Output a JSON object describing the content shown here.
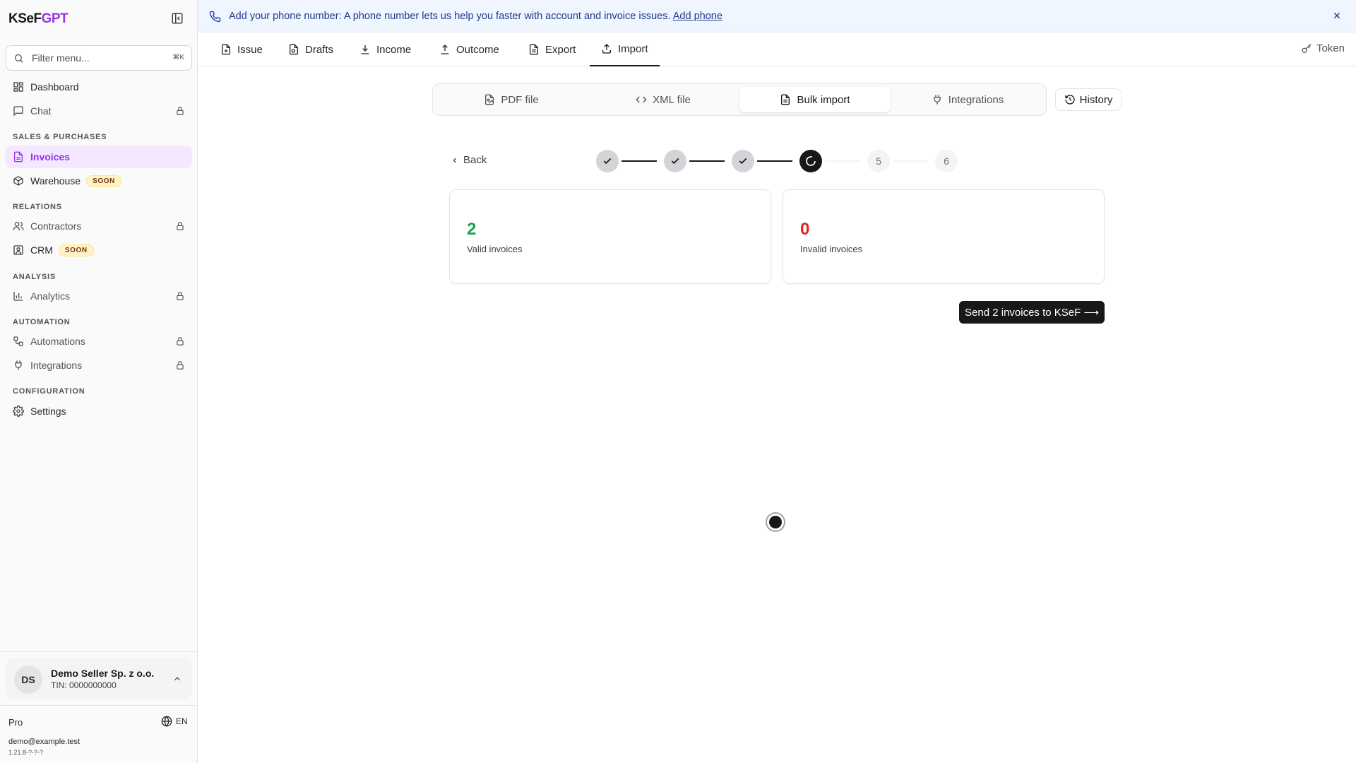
{
  "brand": {
    "prefix": "KSeF",
    "suffix": "GPT"
  },
  "sidebar": {
    "filter_placeholder": "Filter menu...",
    "filter_shortcut": "⌘K",
    "dashboard": "Dashboard",
    "chat": "Chat",
    "sections": {
      "sales": "SALES & PURCHASES",
      "relations": "RELATIONS",
      "analysis": "ANALYSIS",
      "automation": "AUTOMATION",
      "configuration": "CONFIGURATION"
    },
    "invoices": "Invoices",
    "warehouse": "Warehouse",
    "soon_badge": "SOON",
    "contractors": "Contractors",
    "crm": "CRM",
    "analytics": "Analytics",
    "automations": "Automations",
    "integrations": "Integrations",
    "settings": "Settings"
  },
  "account": {
    "initials": "DS",
    "name": "Demo Seller Sp. z o.o.",
    "tin": "TIN: 0000000000"
  },
  "footer": {
    "plan": "Pro",
    "lang": "EN",
    "email": "demo@example.test",
    "version": "1.21.8-?-?-?"
  },
  "banner": {
    "text": "Add your phone number: A phone number lets us help you faster with account and invoice issues.",
    "link": "Add phone"
  },
  "tabs": {
    "issue": "Issue",
    "drafts": "Drafts",
    "income": "Income",
    "outcome": "Outcome",
    "export": "Export",
    "import": "Import",
    "token": "Token"
  },
  "subtabs": {
    "pdf": "PDF file",
    "xml": "XML file",
    "bulk": "Bulk import",
    "integrations": "Integrations",
    "history": "History"
  },
  "wizard": {
    "back": "Back",
    "step5": "5",
    "step6": "6",
    "current_step": 4
  },
  "results": {
    "valid_count": "2",
    "valid_label": "Valid invoices",
    "invalid_count": "0",
    "invalid_label": "Invalid invoices",
    "send_button": "Send 2 invoices to KSeF ⟶"
  },
  "colors": {
    "accent": "#9333ea",
    "valid": "#16a34a",
    "invalid": "#dc2626",
    "banner": "#eff6ff"
  }
}
